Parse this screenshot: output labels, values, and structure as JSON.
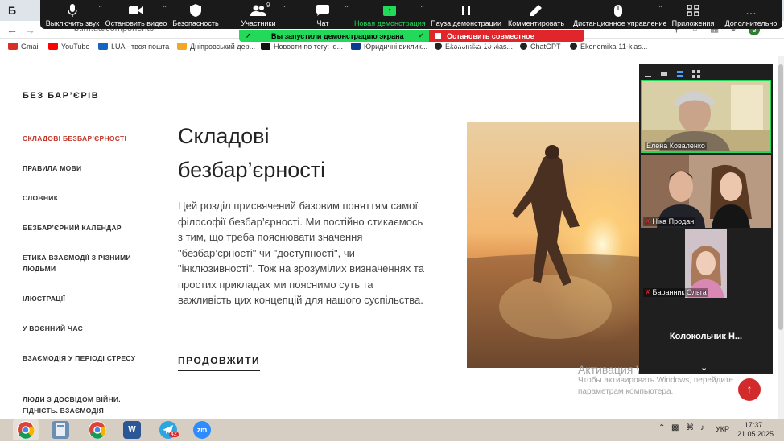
{
  "browser": {
    "tab_favicon": "Б",
    "tab_title": "Б",
    "url": "btim.ua/components",
    "profile_initial": "е",
    "bookmarks": [
      {
        "label": "Gmail",
        "icon": "gmail-icon",
        "color": "#d93025"
      },
      {
        "label": "YouTube",
        "icon": "youtube-icon",
        "color": "#ff0000"
      },
      {
        "label": "I.UA - твоя пошта",
        "icon": "iua-icon",
        "color": "#1565c0"
      },
      {
        "label": "Дніпровський дер...",
        "icon": "dnipro-icon",
        "color": "#f5a623"
      },
      {
        "label": "Новости по тегу: id...",
        "icon": "news-icon",
        "color": "#111111"
      },
      {
        "label": "Юридичні виклик...",
        "icon": "legal-icon",
        "color": "#0a3d91"
      },
      {
        "label": "Ekonomika-10-klas...",
        "icon": "github-icon",
        "color": "#222222"
      },
      {
        "label": "ChatGPT",
        "icon": "chatgpt-icon",
        "color": "#222222"
      },
      {
        "label": "Ekonomika-11-klas...",
        "icon": "github-icon",
        "color": "#222222"
      }
    ]
  },
  "zoom": {
    "toolbar": [
      {
        "label": "Выключить звук",
        "icon": "microphone-icon"
      },
      {
        "label": "Остановить видео",
        "icon": "video-camera-icon"
      },
      {
        "label": "Безопасность",
        "icon": "shield-icon"
      },
      {
        "label": "Участники",
        "icon": "participants-icon",
        "badge": "9"
      },
      {
        "label": "Чат",
        "icon": "chat-icon"
      },
      {
        "label": "Новая демонстрация",
        "icon": "share-screen-icon"
      },
      {
        "label": "Пауза демонстрации",
        "icon": "pause-icon"
      },
      {
        "label": "Комментировать",
        "icon": "pencil-icon"
      },
      {
        "label": "Дистанционное управление",
        "icon": "mouse-icon"
      },
      {
        "label": "Приложения",
        "icon": "apps-icon"
      },
      {
        "label": "Дополнительно",
        "icon": "more-icon"
      }
    ],
    "share_banner": "Вы запустили демонстрацию экрана",
    "stop_share": "Остановить совместное использование",
    "participants": [
      {
        "name": "Елена Коваленко",
        "muted": false
      },
      {
        "name": "Ніка Продан",
        "muted": true
      },
      {
        "name": "Баранник Ольга",
        "muted": true
      },
      {
        "name": "Колокольчик  Н...",
        "muted": false
      }
    ],
    "accent_green": "#23d959",
    "accent_red": "#e0262a"
  },
  "site": {
    "brand": "БЕЗ БАР’ЄРІВ",
    "nav": [
      "СКЛАДОВІ БЕЗБАР’ЄРНОСТІ",
      "ПРАВИЛА МОВИ",
      "СЛОВНИК",
      "БЕЗБАР’ЄРНИЙ КАЛЕНДАР",
      "ЕТИКА ВЗАЄМОДІЇ З РІЗНИМИ ЛЮДЬМИ",
      "ІЛЮСТРАЦІЇ",
      "У ВОЄННИЙ ЧАС",
      "ВЗАЄМОДІЯ У ПЕРІОДІ СТРЕСУ",
      "ЛЮДИ З ДОСВІДОМ ВІЙНИ. ГІДНІСТЬ. ВЗАЄМОДІЯ"
    ],
    "heading_line1": "Складові",
    "heading_line2": "безбар’єрності",
    "description": "Цей розділ присвячений базовим поняттям самої філософії безбар’єрності. Ми постійно стикаємось з тим, що треба пояснювати значення \"безбар’єрності\" чи \"доступності\", чи \"інклюзивності\". Тож на зрозумілих визначеннях та простих прикладах ми пояснимо суть та важливість цих концепцій для нашого суспільства.",
    "continue": "ПРОДОВЖИТИ",
    "accent": "#c0392b"
  },
  "windows": {
    "activate_title": "Активация Windows",
    "activate_line1": "Чтобы активировать Windows, перейдите",
    "activate_line2": "параметрам компьютера.",
    "taskbar_apps": [
      {
        "name": "chrome-profile-icon"
      },
      {
        "name": "calculator-icon"
      },
      {
        "name": "chrome-icon"
      },
      {
        "name": "word-icon",
        "label": "W"
      },
      {
        "name": "telegram-icon",
        "badge": "42"
      },
      {
        "name": "zoom-icon",
        "label": "zm"
      }
    ],
    "lang": "УКР",
    "time": "17:37",
    "date": "21.05.2025"
  }
}
